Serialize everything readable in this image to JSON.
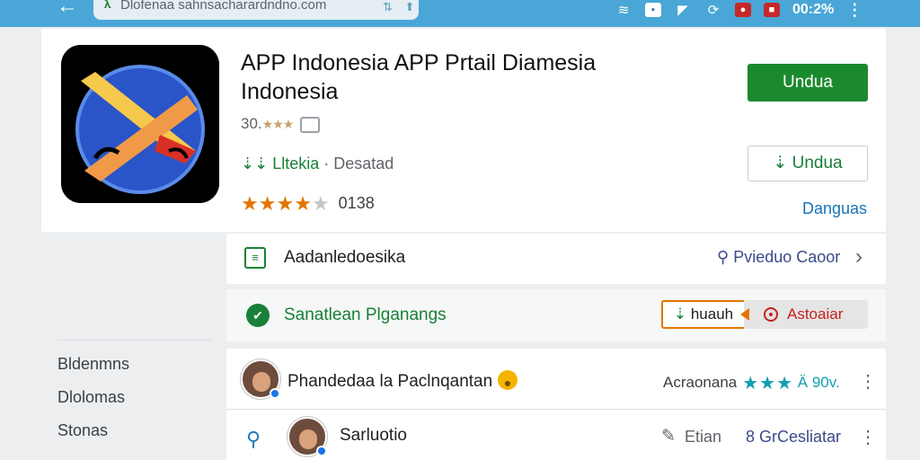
{
  "browser": {
    "url_prefix": "𝛌",
    "url_text": "Dlofenaa sahnsacharardndno.com",
    "url_icons": [
      "sort-icon",
      "share-icon"
    ]
  },
  "status_bar": {
    "battery_text": "00:2%",
    "icons": [
      "wifi-icon",
      "sim-icon",
      "signal-icon",
      "sync-icon",
      "record-icon",
      "stop-icon"
    ]
  },
  "app": {
    "title": "APP Indonesia APP Prtail Diamesia Indonesia",
    "small_rating": "30.",
    "small_rating_stars": "★★★",
    "developer": "Lltekia",
    "category": "Desatad",
    "rating_count": "0138",
    "stars_filled": 4,
    "stars_total": 5,
    "install_label": "Undua",
    "secondary_install_label": "Undua",
    "more_link": "Danguas",
    "colors": {
      "accent_green": "#1b8a2e",
      "star_orange": "#e37400",
      "topbar_blue": "#4aa6d6"
    }
  },
  "about_row": {
    "label": "Aadanledoesika",
    "link": "Pvieduo Caoor"
  },
  "safety_row": {
    "label": "Sanatlean Plganangs",
    "tag_label": "huauh",
    "tag2_label": "Astoaiar"
  },
  "sidebar": {
    "items": [
      "Bldenmns",
      "Dlolomas",
      "Stonas"
    ]
  },
  "reviews": [
    {
      "name": "Phandedaa la Paclnqantan",
      "meta_label": "Acraonana",
      "stars": "★★★",
      "tail": "Ä 90v."
    },
    {
      "name": "Sarluotio",
      "edit_label": "Etian",
      "report_label": "8 GrCesliatar"
    }
  ]
}
